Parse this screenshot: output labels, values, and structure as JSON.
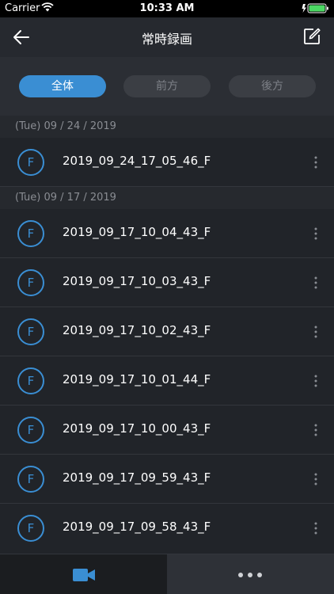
{
  "status_bar": {
    "carrier": "Carrier",
    "time": "10:33 AM"
  },
  "nav": {
    "title": "常時録画",
    "back_icon": "back-arrow-icon",
    "edit_icon": "edit-icon"
  },
  "filters": [
    {
      "label": "全体",
      "active": true
    },
    {
      "label": "前方",
      "active": false
    },
    {
      "label": "後方",
      "active": false
    }
  ],
  "sections": [
    {
      "header": "(Tue) 09 / 24 / 2019",
      "items": [
        {
          "icon": "F",
          "label": "2019_09_24_17_05_46_F"
        }
      ]
    },
    {
      "header": "(Tue) 09 / 17 / 2019",
      "items": [
        {
          "icon": "F",
          "label": "2019_09_17_10_04_43_F"
        },
        {
          "icon": "F",
          "label": "2019_09_17_10_03_43_F"
        },
        {
          "icon": "F",
          "label": "2019_09_17_10_02_43_F"
        },
        {
          "icon": "F",
          "label": "2019_09_17_10_01_44_F"
        },
        {
          "icon": "F",
          "label": "2019_09_17_10_00_43_F"
        },
        {
          "icon": "F",
          "label": "2019_09_17_09_59_43_F"
        },
        {
          "icon": "F",
          "label": "2019_09_17_09_58_43_F"
        }
      ]
    }
  ],
  "tab_bar": {
    "left_icon": "video-camera-icon",
    "right_icon": "more-horizontal-icon"
  },
  "colors": {
    "accent": "#3a8ed3",
    "background": "#1f2227"
  }
}
